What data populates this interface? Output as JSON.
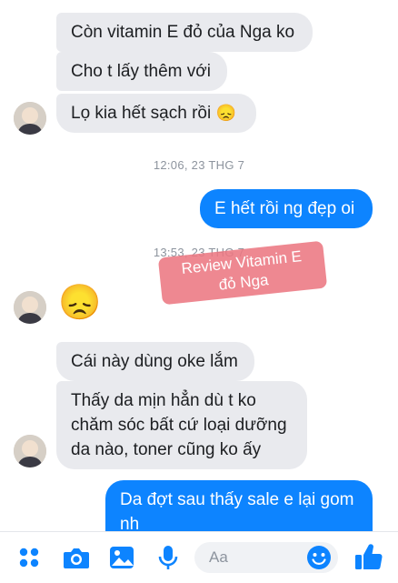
{
  "messages": {
    "m1": "Còn vitamin E đỏ của Nga ko",
    "m2": "Cho t lấy thêm với",
    "m3": "Lọ kia hết sạch rồi",
    "m3_emoji": "😞",
    "m4": "E hết rồi ng đẹp oi",
    "m5_emoji": "😞",
    "m6": "Cái này dùng oke lắm",
    "m7_line1": "Thấy da mịn hẳn dù t ko",
    "m7_line2": "chăm sóc bất cứ loại dưỡng",
    "m7_line3": "da nào, toner cũng ko ấy",
    "m8_line1": "Da đợt sau thấy sale e lại gom",
    "m8_line2": "nh"
  },
  "timestamps": {
    "t1": "12:06, 23 THG 7",
    "t2": "13:53, 23 THG 7"
  },
  "watermark": {
    "line1": "Review Vitamin E",
    "line2": "đỏ Nga"
  },
  "composer": {
    "placeholder": "Aa"
  },
  "colors": {
    "accent": "#0d84ff",
    "incoming_bubble": "#e9eaee",
    "watermark": "#ec7882"
  },
  "icons": [
    "apps-icon",
    "camera-icon",
    "photo-icon",
    "mic-icon",
    "emoji-icon",
    "like-icon"
  ]
}
